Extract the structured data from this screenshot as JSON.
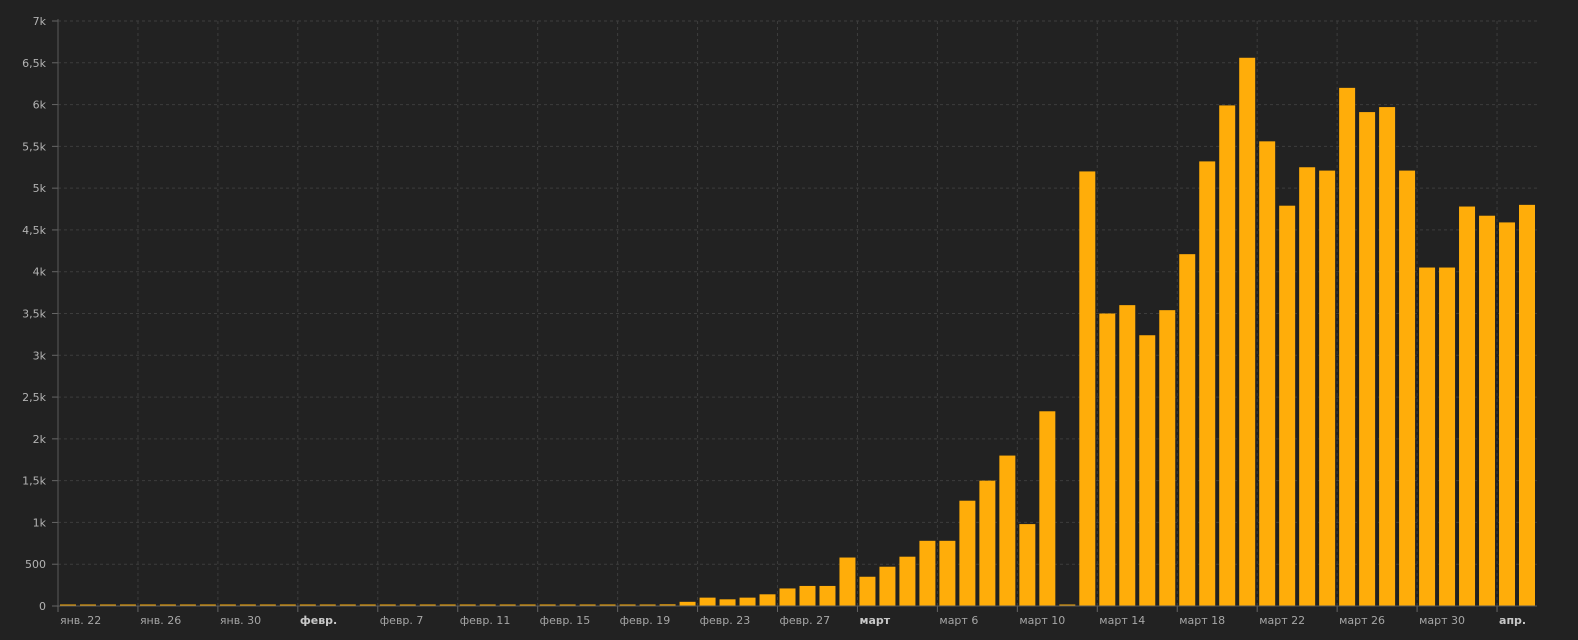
{
  "chart_data": {
    "type": "bar",
    "bar_color": "#ffad0a",
    "background": "#222222",
    "grid": true,
    "ylim": [
      0,
      7000
    ],
    "yticks": [
      {
        "value": 0,
        "label": "0"
      },
      {
        "value": 500,
        "label": "500"
      },
      {
        "value": 1000,
        "label": "1k"
      },
      {
        "value": 1500,
        "label": "1,5k"
      },
      {
        "value": 2000,
        "label": "2k"
      },
      {
        "value": 2500,
        "label": "2,5k"
      },
      {
        "value": 3000,
        "label": "3k"
      },
      {
        "value": 3500,
        "label": "3,5k"
      },
      {
        "value": 4000,
        "label": "4k"
      },
      {
        "value": 4500,
        "label": "4,5k"
      },
      {
        "value": 5000,
        "label": "5k"
      },
      {
        "value": 5500,
        "label": "5,5k"
      },
      {
        "value": 6000,
        "label": "6k"
      },
      {
        "value": 6500,
        "label": "6,5k"
      },
      {
        "value": 7000,
        "label": "7k"
      }
    ],
    "xticks": [
      {
        "index": 0,
        "label": "янв. 22",
        "major": false
      },
      {
        "index": 4,
        "label": "янв. 26",
        "major": false
      },
      {
        "index": 8,
        "label": "янв. 30",
        "major": false
      },
      {
        "index": 12,
        "label": "февр.",
        "major": true
      },
      {
        "index": 16,
        "label": "февр. 7",
        "major": false
      },
      {
        "index": 20,
        "label": "февр. 11",
        "major": false
      },
      {
        "index": 24,
        "label": "февр. 15",
        "major": false
      },
      {
        "index": 28,
        "label": "февр. 19",
        "major": false
      },
      {
        "index": 32,
        "label": "февр. 23",
        "major": false
      },
      {
        "index": 36,
        "label": "февр. 27",
        "major": false
      },
      {
        "index": 40,
        "label": "март",
        "major": true
      },
      {
        "index": 44,
        "label": "март 6",
        "major": false
      },
      {
        "index": 48,
        "label": "март 10",
        "major": false
      },
      {
        "index": 52,
        "label": "март 14",
        "major": false
      },
      {
        "index": 56,
        "label": "март 18",
        "major": false
      },
      {
        "index": 60,
        "label": "март 22",
        "major": false
      },
      {
        "index": 64,
        "label": "март 26",
        "major": false
      },
      {
        "index": 68,
        "label": "март 30",
        "major": false
      },
      {
        "index": 72,
        "label": "апр.",
        "major": true
      }
    ],
    "values": [
      1,
      0,
      0,
      0,
      1,
      0,
      2,
      3,
      0,
      0,
      0,
      1,
      2,
      1,
      0,
      2,
      1,
      0,
      3,
      0,
      0,
      2,
      0,
      0,
      0,
      0,
      0,
      3,
      0,
      2,
      20,
      50,
      100,
      80,
      100,
      140,
      210,
      240,
      240,
      580,
      350,
      470,
      590,
      780,
      780,
      1260,
      1500,
      1800,
      980,
      2330,
      0,
      5200,
      3500,
      3600,
      3240,
      3540,
      4210,
      5320,
      5990,
      6560,
      5560,
      4790,
      5250,
      5210,
      6200,
      5910,
      5970,
      5210,
      4050,
      4050,
      4780,
      4670,
      4590,
      4800
    ]
  }
}
